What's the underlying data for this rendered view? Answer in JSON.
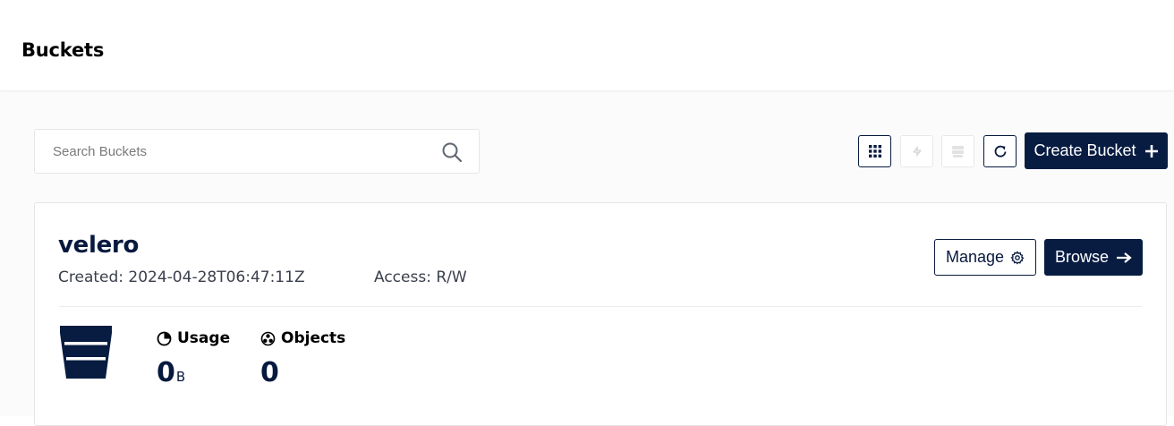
{
  "header": {
    "title": "Buckets"
  },
  "search": {
    "placeholder": "Search Buckets",
    "value": ""
  },
  "toolbar": {
    "create_label": "Create Bucket",
    "buttons": [
      {
        "icon": "grid-select-icon",
        "enabled": true
      },
      {
        "icon": "replication-icon",
        "enabled": false
      },
      {
        "icon": "lifecycle-icon",
        "enabled": false
      },
      {
        "icon": "refresh-icon",
        "enabled": true
      }
    ]
  },
  "buckets": [
    {
      "name": "velero",
      "created": "Created: 2024-04-28T06:47:11Z",
      "access": "Access: R/W",
      "manage_label": "Manage",
      "browse_label": "Browse",
      "usage_label": "Usage",
      "usage_value": "0",
      "usage_unit": "B",
      "objects_label": "Objects",
      "objects_value": "0"
    }
  ],
  "colors": {
    "primary": "#081c42",
    "disabled": "#e8e8e8"
  }
}
